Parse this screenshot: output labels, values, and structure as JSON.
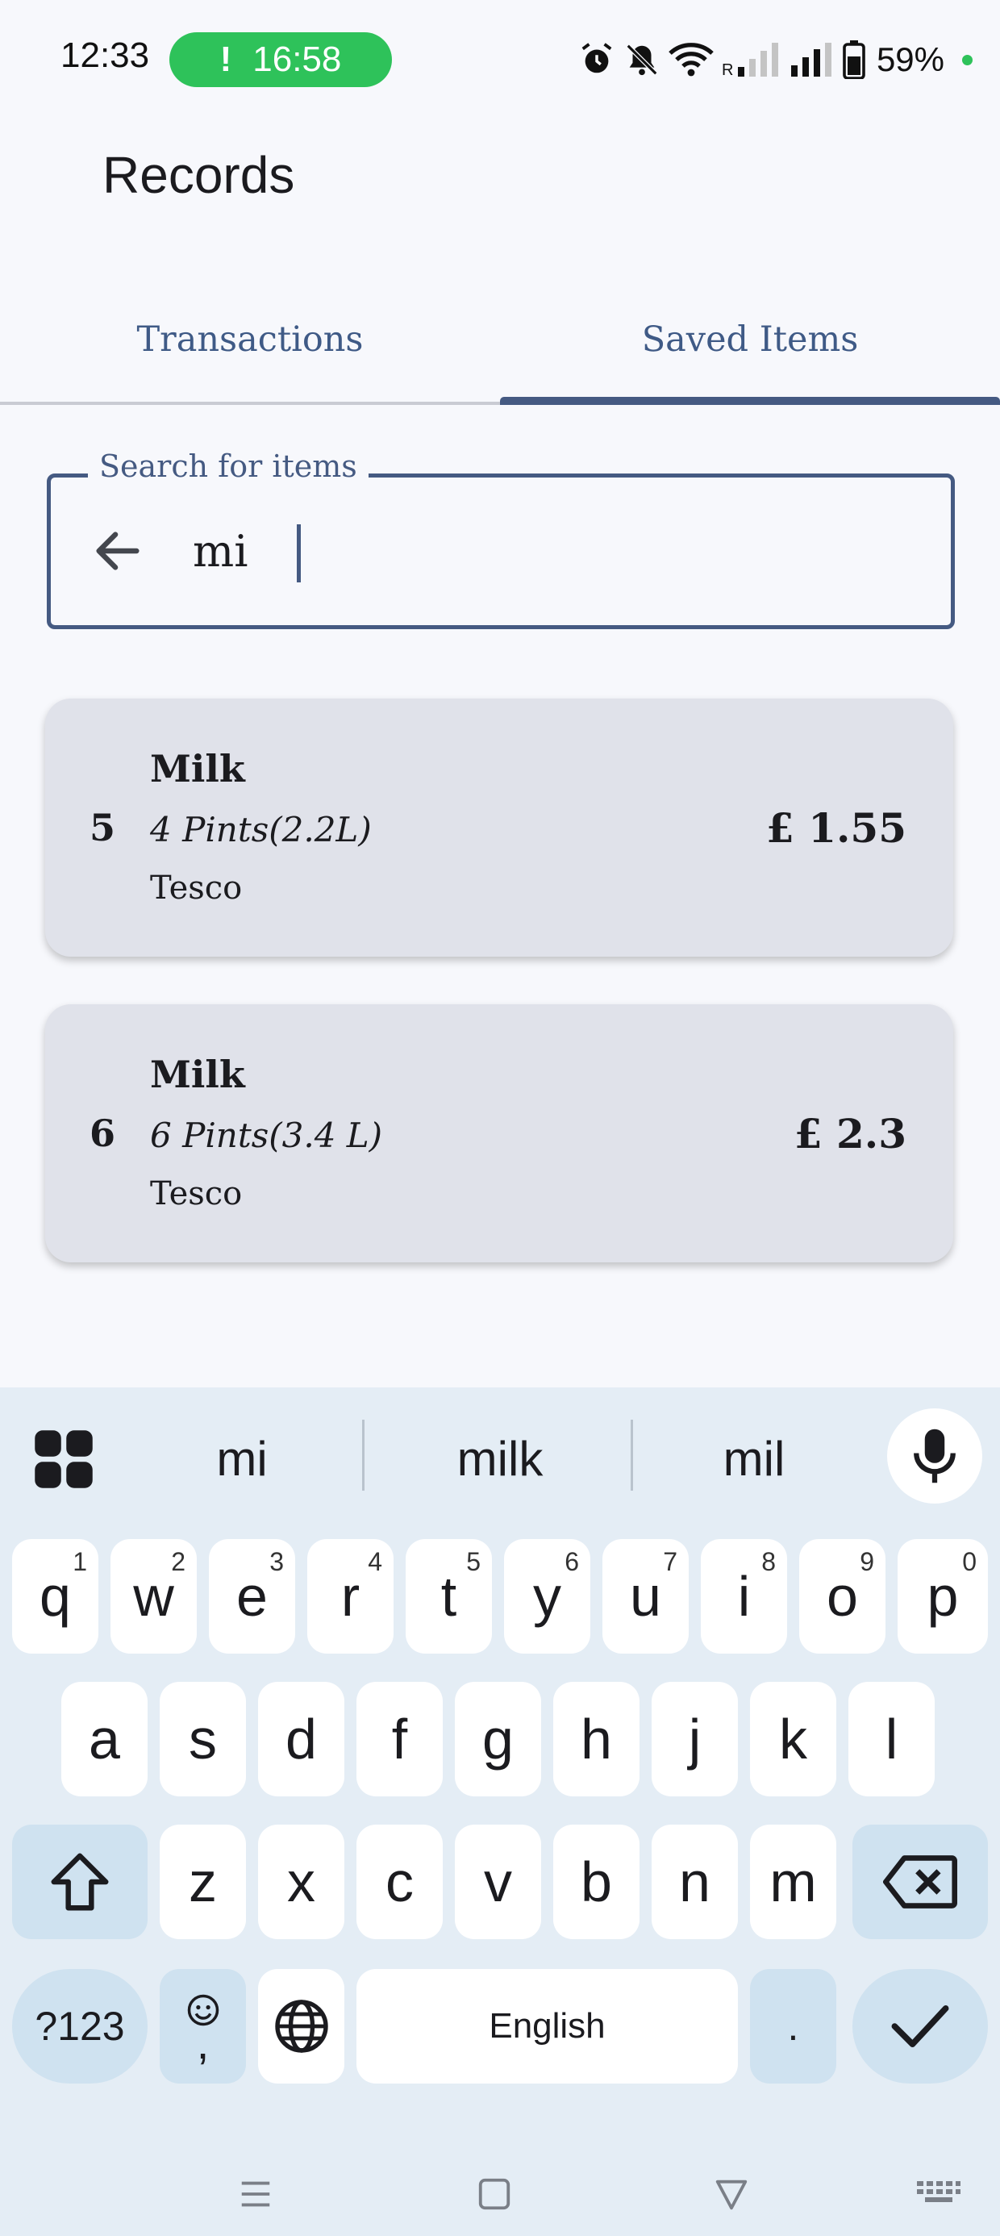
{
  "status_bar": {
    "time": "12:33",
    "call_timer": "16:58",
    "call_icon": "!",
    "battery_percent": "59%",
    "icons": [
      "alarm-icon",
      "mute-icon",
      "wifi-icon",
      "signal-roaming-icon",
      "signal-icon",
      "battery-icon"
    ],
    "dot_color": "#2ec25a"
  },
  "app_bar": {
    "title": "Records"
  },
  "tabs": [
    {
      "label": "Transactions",
      "selected": false
    },
    {
      "label": "Saved Items",
      "selected": true
    }
  ],
  "search": {
    "label": "Search for items",
    "value": "mi",
    "back_icon": "arrow-back-icon"
  },
  "items": [
    {
      "id": "5",
      "name": "Milk",
      "size": "4 Pints(2.2L)",
      "store": "Tesco",
      "price": "£ 1.55"
    },
    {
      "id": "6",
      "name": "Milk",
      "size": "6 Pints(3.4 L)",
      "store": "Tesco",
      "price": "£ 2.3"
    }
  ],
  "keyboard": {
    "suggestions": [
      "mi",
      "milk",
      "mil"
    ],
    "row1": [
      {
        "key": "q",
        "hint": "1"
      },
      {
        "key": "w",
        "hint": "2"
      },
      {
        "key": "e",
        "hint": "3"
      },
      {
        "key": "r",
        "hint": "4"
      },
      {
        "key": "t",
        "hint": "5"
      },
      {
        "key": "y",
        "hint": "6"
      },
      {
        "key": "u",
        "hint": "7"
      },
      {
        "key": "i",
        "hint": "8"
      },
      {
        "key": "o",
        "hint": "9"
      },
      {
        "key": "p",
        "hint": "0"
      }
    ],
    "row2": [
      "a",
      "s",
      "d",
      "f",
      "g",
      "h",
      "j",
      "k",
      "l"
    ],
    "row3": [
      "z",
      "x",
      "c",
      "v",
      "b",
      "n",
      "m"
    ],
    "symbols_label": "?123",
    "emoji_comma_label": ",",
    "space_label": "English",
    "period_label": ".",
    "accent_color": "#455a82"
  },
  "nav_bar": {
    "icons": [
      "menu-icon",
      "home-square-icon",
      "back-triangle-icon",
      "keyboard-icon"
    ]
  }
}
